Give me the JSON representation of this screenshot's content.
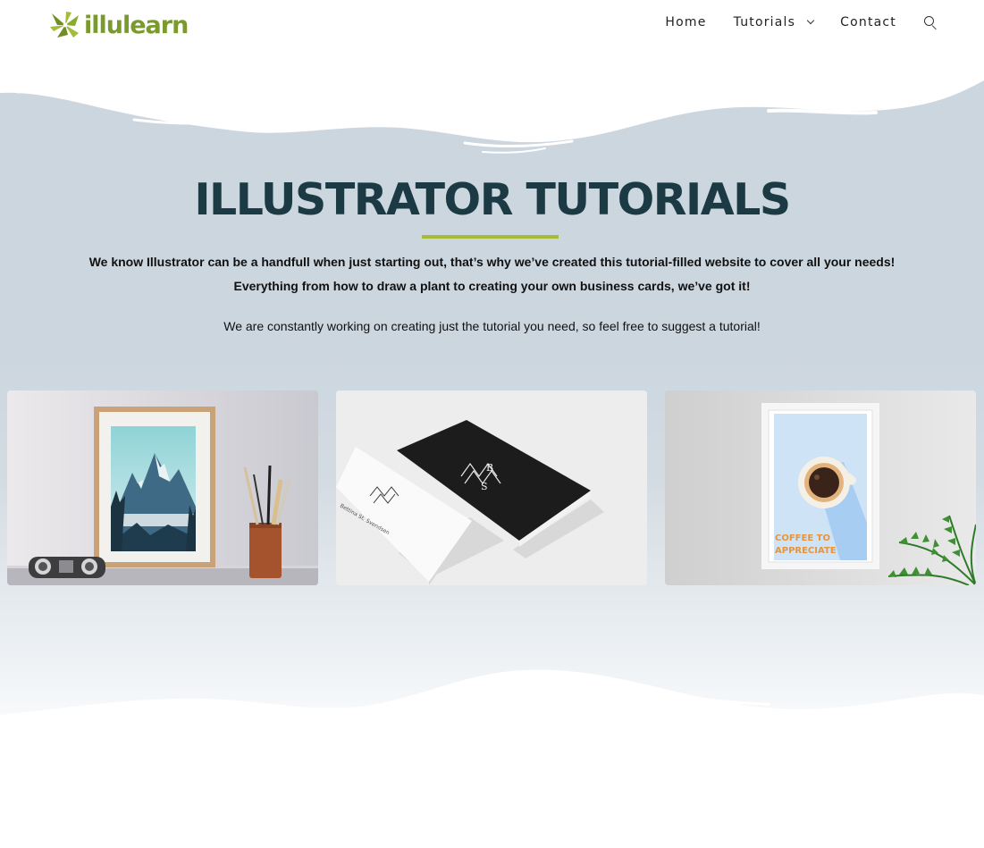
{
  "header": {
    "logo_text": "illulearn",
    "nav": {
      "home": "Home",
      "tutorials": "Tutorials",
      "contact": "Contact"
    },
    "icons": [
      "logo-icon",
      "chevron-down-icon",
      "search-icon"
    ]
  },
  "hero": {
    "title": "ILLUSTRATOR TUTORIALS",
    "lead_line1": "We know Illustrator can be a handfull when just starting out, that’s why we’ve created this tutorial-filled website to cover all your needs!",
    "lead_line2": "Everything from how to draw a plant to creating your own business cards, we’ve got it!",
    "subtext": "We are constantly working on creating just the tutorial you need, so feel free to suggest a tutorial!"
  },
  "cards": [
    {
      "id": "mountain-poster"
    },
    {
      "id": "business-cards",
      "card_monogram_top": "B",
      "card_monogram_bottom": "S",
      "card_name": "Bettina St. Svendsen"
    },
    {
      "id": "coffee-poster",
      "poster_line1": "COFFEE TO",
      "poster_line2": "APPRECIATE"
    }
  ],
  "colors": {
    "brand_green": "#7a9a2e",
    "accent_underline": "#a8bb35",
    "title": "#1b3a44",
    "hero_bg": "#ccd6df"
  }
}
